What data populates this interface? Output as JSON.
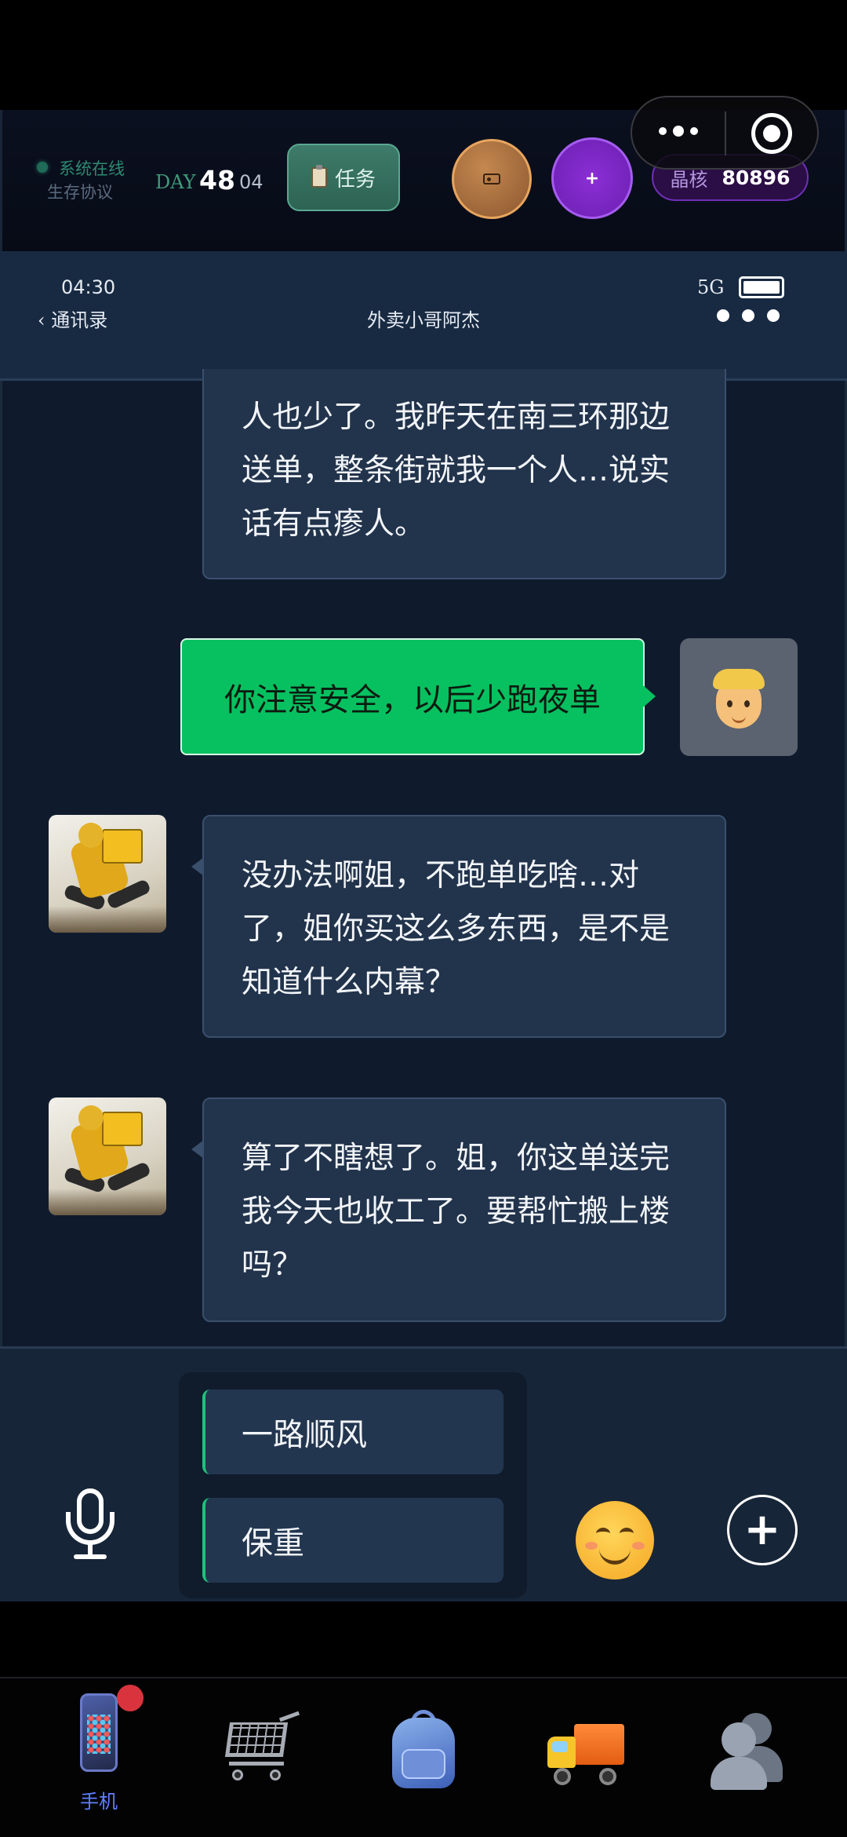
{
  "game_bar": {
    "status": "系统在线",
    "protocol": "生存协议",
    "day_label": "DAY",
    "day_number": "48",
    "day_sub": "04",
    "task_label": "任务",
    "add_label": "+",
    "crystal_label": "晶核",
    "crystal_value": "80896"
  },
  "phone_header": {
    "time": "04:30",
    "back_label": "通讯录",
    "contact_name": "外卖小哥阿杰",
    "network": "5G"
  },
  "messages": [
    {
      "sender": "contact",
      "text": "人也少了。我昨天在南三环那边送单，整条街就我一个人…说实话有点瘆人。"
    },
    {
      "sender": "self",
      "text": "你注意安全，以后少跑夜单"
    },
    {
      "sender": "contact",
      "text": "没办法啊姐，不跑单吃啥…对了，姐你买这么多东西，是不是知道什么内幕？"
    },
    {
      "sender": "contact",
      "text": "算了不瞎想了。姐，你这单送完我今天也收工了。要帮忙搬上楼吗？"
    }
  ],
  "quick_replies": [
    "一路顺风",
    "保重"
  ],
  "add_button": "+",
  "bottom_nav": {
    "items": [
      {
        "id": "phone",
        "label": "手机",
        "icon": "phone-icon",
        "active": true,
        "badge": true
      },
      {
        "id": "shop",
        "icon": "cart-icon"
      },
      {
        "id": "backpack",
        "icon": "backpack-icon"
      },
      {
        "id": "delivery",
        "icon": "truck-icon"
      },
      {
        "id": "contacts",
        "icon": "people-icon"
      }
    ],
    "active_color": "#5f7fff"
  },
  "colors": {
    "self_bubble": "#07c160",
    "contact_bubble": "#22334c",
    "background": "#0f1b2d"
  }
}
